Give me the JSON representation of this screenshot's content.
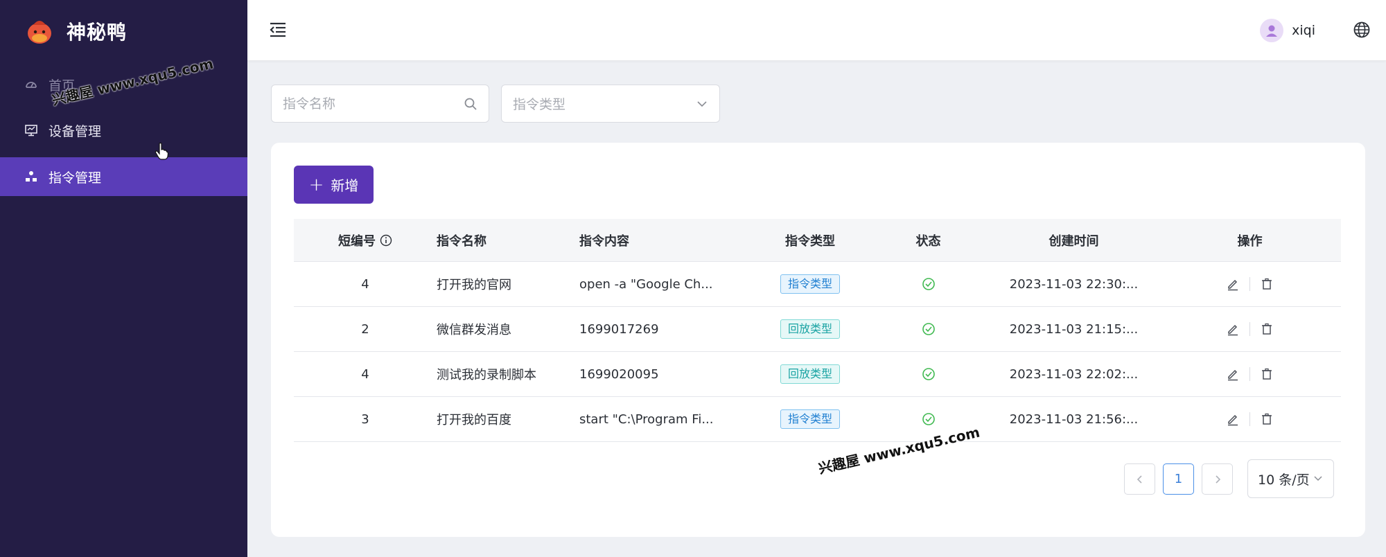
{
  "app": {
    "name": "神秘鸭"
  },
  "sidebar": {
    "items": [
      {
        "label": "首页",
        "icon": "dashboard-icon",
        "active": false
      },
      {
        "label": "设备管理",
        "icon": "monitor-icon",
        "active": false
      },
      {
        "label": "指令管理",
        "icon": "hierarchy-icon",
        "active": true
      }
    ]
  },
  "header": {
    "user": {
      "name": "xiqi"
    }
  },
  "filters": {
    "name_placeholder": "指令名称",
    "type_placeholder": "指令类型"
  },
  "toolbar": {
    "add_label": "新增"
  },
  "table": {
    "columns": [
      "短编号",
      "指令名称",
      "指令内容",
      "指令类型",
      "状态",
      "创建时间",
      "操作"
    ],
    "rows": [
      {
        "short_id": "4",
        "name": "打开我的官网",
        "content": "open -a \"Google Ch...",
        "type": "指令类型",
        "type_kind": "cmd",
        "status": "enabled",
        "created": "2023-11-03 22:30:..."
      },
      {
        "short_id": "2",
        "name": "微信群发消息",
        "content": "1699017269",
        "type": "回放类型",
        "type_kind": "replay",
        "status": "enabled",
        "created": "2023-11-03 21:15:..."
      },
      {
        "short_id": "4",
        "name": "测试我的录制脚本",
        "content": "1699020095",
        "type": "回放类型",
        "type_kind": "replay",
        "status": "enabled",
        "created": "2023-11-03 22:02:..."
      },
      {
        "short_id": "3",
        "name": "打开我的百度",
        "content": "start \"C:\\Program Fi...",
        "type": "指令类型",
        "type_kind": "cmd",
        "status": "enabled",
        "created": "2023-11-03 21:56:..."
      }
    ]
  },
  "pagination": {
    "current": "1",
    "page_size": "10 条/页"
  },
  "watermarks": [
    "兴趣屋 www.xqu5.com",
    "兴趣屋 www.xqu5.com"
  ],
  "colors": {
    "sidebar_bg": "#241d45",
    "accent": "#5a35b5",
    "active_nav": "#5a3db8",
    "status_ok": "#3fb950"
  }
}
